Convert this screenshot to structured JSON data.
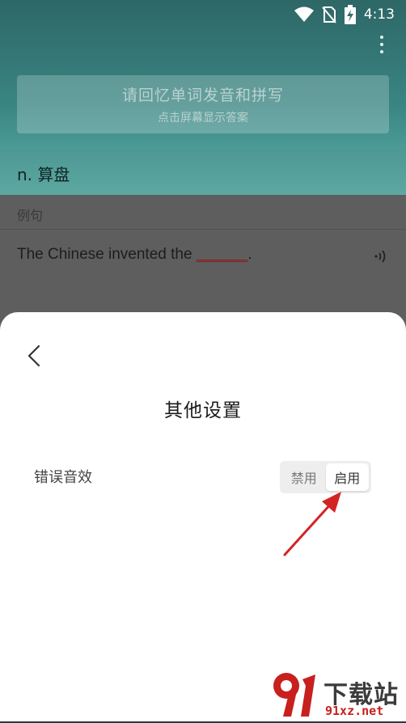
{
  "status_bar": {
    "time": "4:13"
  },
  "study": {
    "prompt_title": "请回忆单词发音和拼写",
    "prompt_subtitle": "点击屏幕显示答案",
    "word_meaning": "n. 算盘",
    "example_label": "例句",
    "example_sentence_prefix": "The Chinese invented the ",
    "example_blank": "______",
    "example_sentence_suffix": "."
  },
  "sheet": {
    "title": "其他设置",
    "setting_label": "错误音效",
    "options": [
      "禁用",
      "启用"
    ],
    "selected": "启用"
  },
  "watermark": {
    "text": "下载站",
    "url": "91xz.net"
  },
  "colors": {
    "accent_arrow": "#d32424",
    "hero": "#3a8683"
  }
}
